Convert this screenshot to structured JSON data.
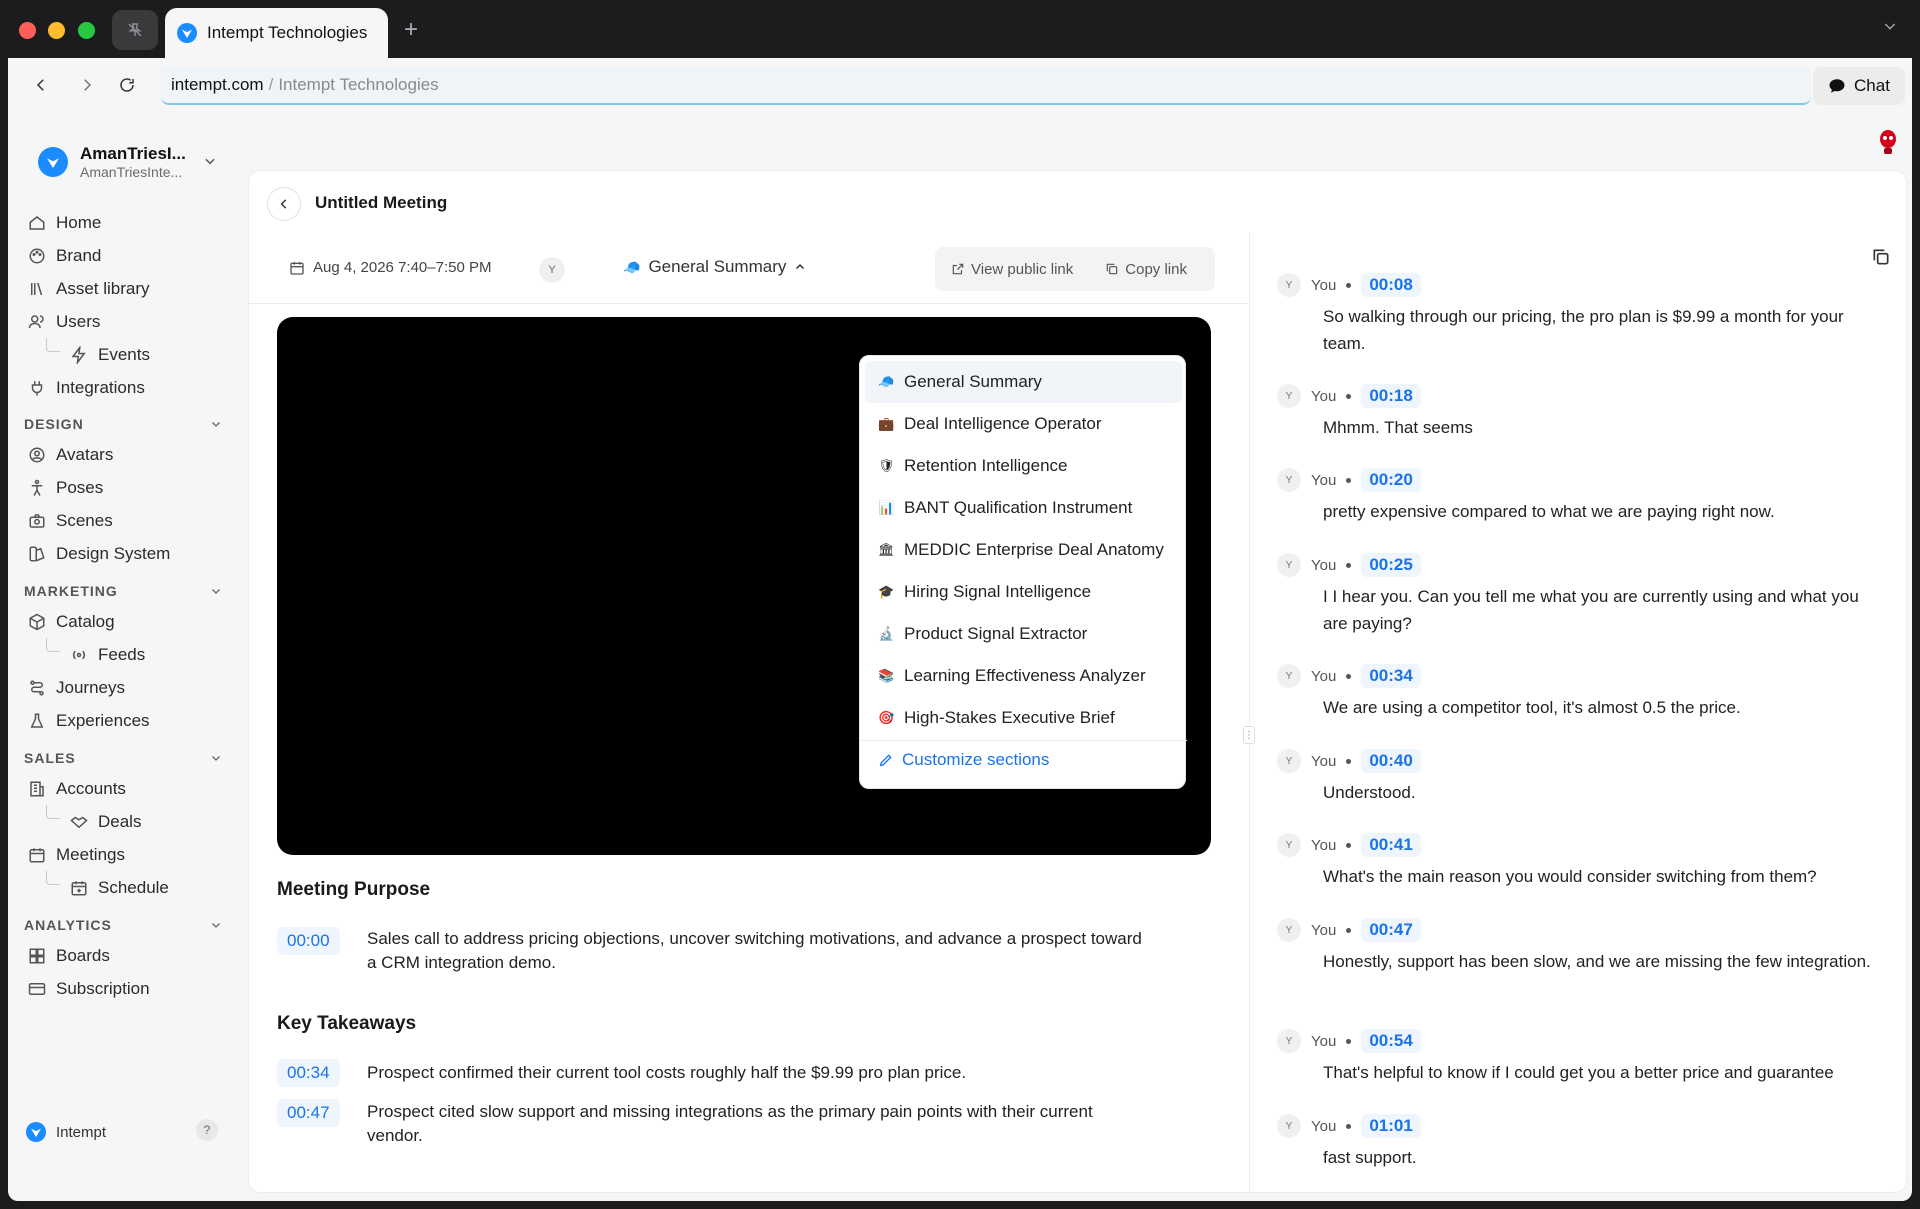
{
  "browser": {
    "tab_title": "Intempt Technologies",
    "url_domain": "intempt.com",
    "url_separator": "/",
    "url_page_title": "Intempt Technologies",
    "chat_label": "Chat"
  },
  "workspace": {
    "name": "AmanTriesI...",
    "subtitle": "AmanTriesInte..."
  },
  "sidebar": {
    "items": [
      {
        "label": "Home",
        "icon": "home-icon"
      },
      {
        "label": "Brand",
        "icon": "palette-icon"
      },
      {
        "label": "Asset library",
        "icon": "library-icon"
      },
      {
        "label": "Users",
        "icon": "users-icon"
      },
      {
        "label": "Events",
        "icon": "bolt-icon"
      },
      {
        "label": "Integrations",
        "icon": "plug-icon"
      }
    ],
    "sections": {
      "design": {
        "label": "DESIGN",
        "items": [
          "Avatars",
          "Poses",
          "Scenes",
          "Design System"
        ]
      },
      "marketing": {
        "label": "MARKETING",
        "items": [
          "Catalog",
          "Feeds",
          "Journeys",
          "Experiences"
        ]
      },
      "sales": {
        "label": "SALES",
        "items": [
          "Accounts",
          "Deals",
          "Meetings",
          "Schedule"
        ]
      },
      "analytics": {
        "label": "ANALYTICS",
        "items": [
          "Boards",
          "Subscription"
        ]
      }
    },
    "footer_label": "Intempt",
    "help_label": "?"
  },
  "meeting": {
    "title": "Untitled Meeting",
    "date": "Aug 4, 2026 7:40–7:50 PM",
    "attendee_initial": "Y",
    "summary_selected": "General Summary",
    "view_public_link": "View public link",
    "copy_link": "Copy link"
  },
  "dropdown": {
    "options": [
      {
        "emoji": "🧢",
        "label": "General Summary"
      },
      {
        "emoji": "💼",
        "label": "Deal Intelligence Operator"
      },
      {
        "emoji": "🛡",
        "label": "Retention Intelligence"
      },
      {
        "emoji": "📊",
        "label": "BANT Qualification Instrument"
      },
      {
        "emoji": "🏛",
        "label": "MEDDIC Enterprise Deal Anatomy"
      },
      {
        "emoji": "🎓",
        "label": "Hiring Signal Intelligence"
      },
      {
        "emoji": "🔬",
        "label": "Product Signal Extractor"
      },
      {
        "emoji": "📚",
        "label": "Learning Effectiveness Analyzer"
      },
      {
        "emoji": "🎯",
        "label": "High-Stakes Executive Brief"
      }
    ],
    "customize_label": "Customize sections"
  },
  "summary": {
    "purpose_heading": "Meeting Purpose",
    "purpose": {
      "ts": "00:00",
      "text": "Sales call to address pricing objections, uncover switching motivations, and advance a prospect toward a CRM integration demo."
    },
    "takeaways_heading": "Key Takeaways",
    "takeaways": [
      {
        "ts": "00:34",
        "text": "Prospect confirmed their current tool costs roughly half the $9.99 pro plan price."
      },
      {
        "ts": "00:47",
        "text": "Prospect cited slow support and missing integrations as the primary pain points with their current vendor."
      }
    ]
  },
  "transcript": [
    {
      "initial": "Y",
      "speaker": "You",
      "ts": "00:08",
      "text": "So walking through our pricing, the pro plan is $9.99 a month for your team."
    },
    {
      "initial": "Y",
      "speaker": "You",
      "ts": "00:18",
      "text": "Mhmm. That seems"
    },
    {
      "initial": "Y",
      "speaker": "You",
      "ts": "00:20",
      "text": "pretty expensive compared to what we are paying right now."
    },
    {
      "initial": "Y",
      "speaker": "You",
      "ts": "00:25",
      "text": "I I hear you. Can you tell me what you are currently using and what you are paying?"
    },
    {
      "initial": "Y",
      "speaker": "You",
      "ts": "00:34",
      "text": "We are using a competitor tool, it's almost 0.5 the price."
    },
    {
      "initial": "Y",
      "speaker": "You",
      "ts": "00:40",
      "text": "Understood."
    },
    {
      "initial": "Y",
      "speaker": "You",
      "ts": "00:41",
      "text": "What's the main reason you would consider switching from them?"
    },
    {
      "initial": "Y",
      "speaker": "You",
      "ts": "00:47",
      "text": "Honestly, support has been slow, and we are missing the few integration."
    },
    {
      "initial": "Y",
      "speaker": "You",
      "ts": "00:54",
      "text": "That's helpful to know if I could get you a better price and guarantee"
    },
    {
      "initial": "Y",
      "speaker": "You",
      "ts": "01:01",
      "text": "fast support."
    }
  ],
  "colors": {
    "accent": "#1a73e8",
    "brand": "#1a8cff",
    "timestamp_bg": "#eef5fc"
  }
}
